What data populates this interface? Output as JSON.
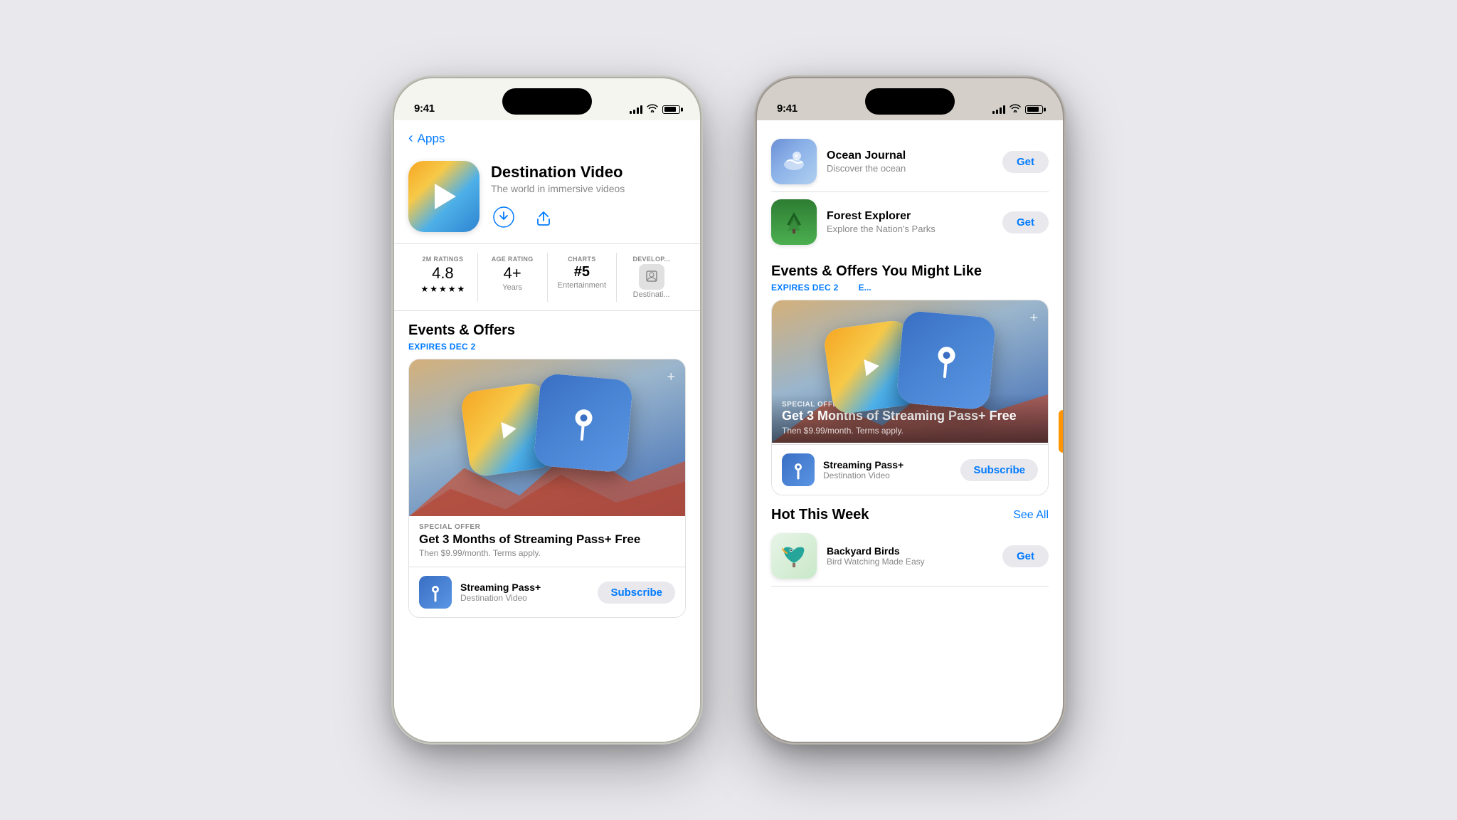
{
  "page": {
    "bg_color": "#e8e8ed"
  },
  "phone1": {
    "status": {
      "time": "9:41",
      "signal": 4,
      "wifi": true,
      "battery": 80
    },
    "nav": {
      "back_label": "Apps"
    },
    "app": {
      "name": "Destination Video",
      "subtitle": "The world in immersive videos",
      "ratings_count": "2M RATINGS",
      "rating_value": "4.8",
      "age_rating_label": "AGE RATING",
      "age_rating_value": "4+",
      "age_rating_sub": "Years",
      "charts_label": "CHARTS",
      "charts_value": "#5",
      "charts_sub": "Entertainment",
      "developer_label": "DEVELOP...",
      "developer_value": "Destinati..."
    },
    "events": {
      "section_title": "Events & Offers",
      "expires_label": "EXPIRES DEC 2",
      "offer_type": "SPECIAL OFFER",
      "offer_title": "Get 3 Months of Streaming Pass+ Free",
      "offer_sub": "Then $9.99/month. Terms apply.",
      "subscribe_name": "Streaming Pass+",
      "subscribe_app": "Destination Video",
      "subscribe_btn": "Subscribe"
    }
  },
  "phone2": {
    "status": {
      "time": "9:41",
      "signal": 4,
      "wifi": true,
      "battery": 80
    },
    "app_list": [
      {
        "name": "Ocean Journal",
        "desc": "Discover the ocean",
        "btn": "Get",
        "icon_type": "ocean"
      },
      {
        "name": "Forest Explorer",
        "desc": "Explore the Nation's Parks",
        "btn": "Get",
        "icon_type": "forest"
      }
    ],
    "events": {
      "section_title": "Events & Offers You Might Like",
      "expires_label": "EXPIRES DEC 2",
      "expires_label2": "E...",
      "offer_type": "SPECIAL OFFER",
      "offer_title": "Get 3 Months of Streaming Pass+ Free",
      "offer_sub": "Then $9.99/month. Terms apply.",
      "subscribe_name": "Streaming Pass+",
      "subscribe_app": "Destination Video",
      "subscribe_btn": "Subscribe"
    },
    "hot": {
      "section_title": "Hot This Week",
      "see_all": "See All",
      "items": [
        {
          "name": "Backyard Birds",
          "desc": "Bird Watching Made Easy",
          "btn": "Get",
          "icon_type": "birds"
        }
      ]
    }
  }
}
